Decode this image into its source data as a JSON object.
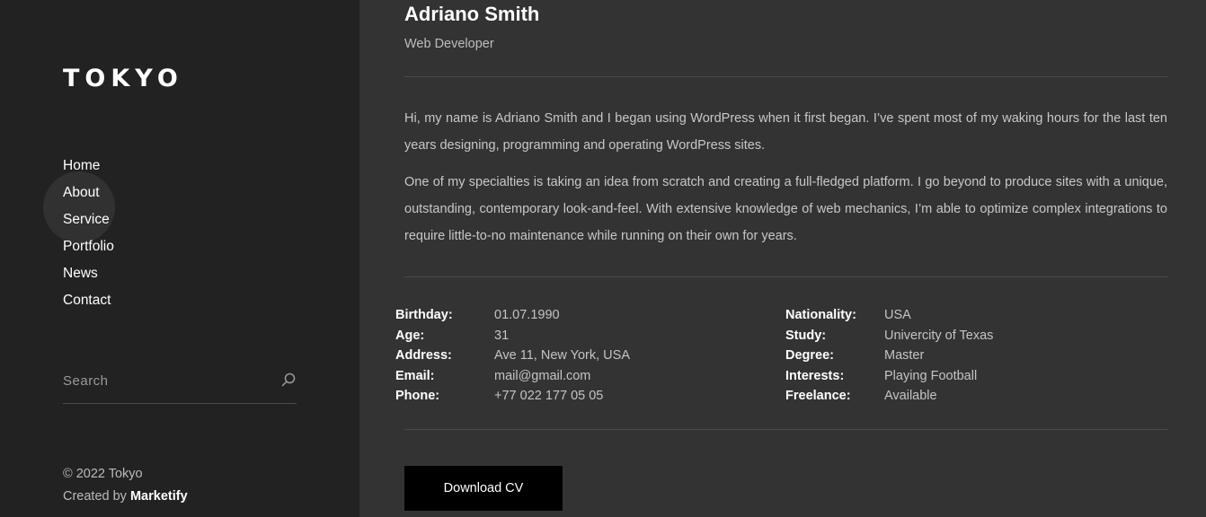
{
  "sidebar": {
    "logo": "TOKYO",
    "nav": [
      {
        "label": "Home"
      },
      {
        "label": "About"
      },
      {
        "label": "Service"
      },
      {
        "label": "Portfolio"
      },
      {
        "label": "News"
      },
      {
        "label": "Contact"
      }
    ],
    "search": {
      "placeholder": "Search"
    },
    "copyright": "© 2022 Tokyo",
    "created_by_prefix": "Created by",
    "created_by_name": "Marketify"
  },
  "profile": {
    "name": "Adriano Smith",
    "role": "Web Developer",
    "bio": [
      "Hi, my name is Adriano Smith and I began using WordPress when it first began. I’ve spent most of my waking hours for the last ten years designing, programming and operating WordPress sites.",
      "One of my specialties is taking an idea from scratch and creating a full-fledged platform. I go beyond to produce sites with a unique, outstanding, contemporary look-and-feel. With extensive knowledge of web mechanics, I’m able to optimize complex integrations to require little-to-no maintenance while running on their own for years."
    ],
    "info_left": [
      {
        "label": "Birthday:",
        "value": "01.07.1990"
      },
      {
        "label": "Age:",
        "value": "31"
      },
      {
        "label": "Address:",
        "value": "Ave 11, New York, USA"
      },
      {
        "label": "Email:",
        "value": "mail@gmail.com"
      },
      {
        "label": "Phone:",
        "value": "+77 022 177 05 05"
      }
    ],
    "info_right": [
      {
        "label": "Nationality:",
        "value": "USA"
      },
      {
        "label": "Study:",
        "value": "Univercity of Texas"
      },
      {
        "label": "Degree:",
        "value": "Master"
      },
      {
        "label": "Interests:",
        "value": "Playing Football"
      },
      {
        "label": "Freelance:",
        "value": "Available"
      }
    ],
    "download_label": "Download CV"
  }
}
